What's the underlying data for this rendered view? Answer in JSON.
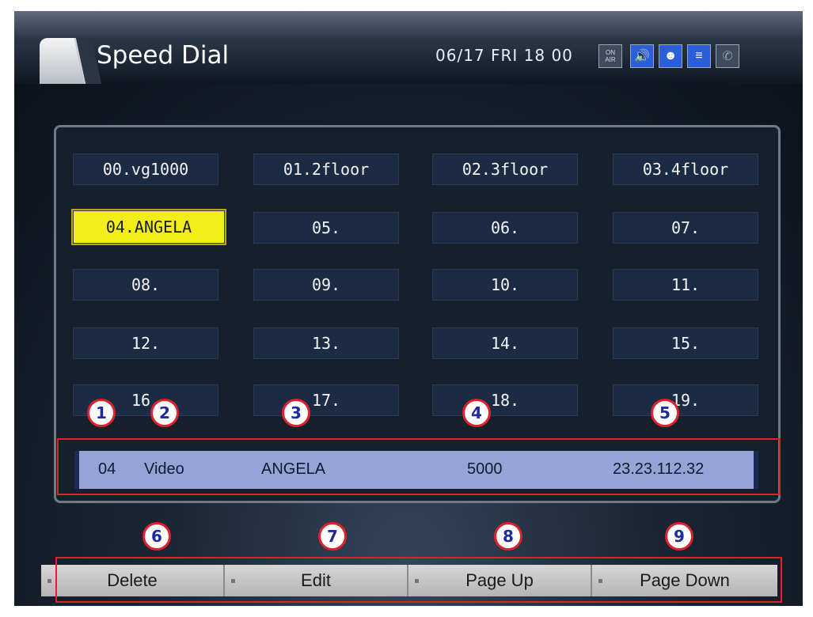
{
  "header": {
    "title": "Speed Dial",
    "datetime": "06/17 FRI 18 00",
    "status_icons": {
      "onair": "ON\nAIR",
      "icons": [
        "onair-icon",
        "speaker-icon",
        "person-icon",
        "network-icon",
        "phone-icon"
      ]
    }
  },
  "speed_dial": {
    "entries": [
      "00.vg1000",
      "01.2floor",
      "02.3floor",
      "03.4floor",
      "04.ANGELA",
      "05.",
      "06.",
      "07.",
      "08.",
      "09.",
      "10.",
      "11.",
      "12.",
      "13.",
      "14.",
      "15.",
      "16.",
      "17.",
      "18.",
      "19."
    ],
    "selected_index": 4
  },
  "detail": {
    "index": "04",
    "type": "Video",
    "name": "ANGELA",
    "number": "5000",
    "address": "23.23.112.32"
  },
  "buttons": {
    "delete": "Delete",
    "edit": "Edit",
    "page_up": "Page Up",
    "page_down": "Page Down"
  },
  "annotations": [
    "1",
    "2",
    "3",
    "4",
    "5",
    "6",
    "7",
    "8",
    "9"
  ],
  "colors": {
    "selected_cell": "#f2ee1b",
    "cell": "#1c2b44",
    "detail_bar": "#95a3d6",
    "annotation_border": "#e0202a"
  }
}
